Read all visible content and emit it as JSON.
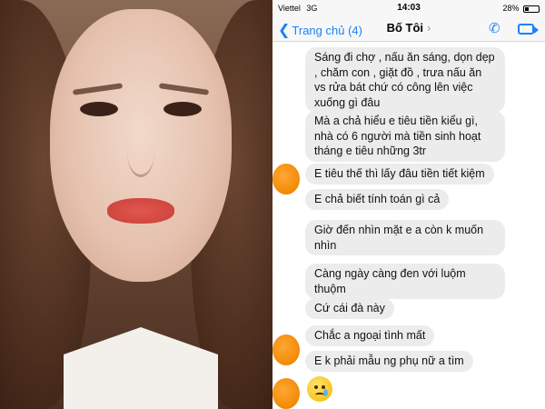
{
  "status_bar": {
    "carrier": "Viettel",
    "network": "3G",
    "time": "14:03",
    "battery": "28%"
  },
  "nav": {
    "back_label": "Trang chủ (4)",
    "contact_name": "Bố Tôi"
  },
  "messages": [
    "Sáng đi chợ , nấu ăn sáng, dọn dẹp , chăm con , giặt đồ , trưa nấu ăn vs rửa bát chứ có công lên việc xuống gì đâu",
    "Mà a chả hiểu e tiêu tiền kiểu gì, nhà có 6 người mà tiền sinh hoạt tháng e tiêu những 3tr",
    "E tiêu thế thì lấy đâu tiền tiết kiệm",
    "E chả biết tính toán gì cả",
    "Giờ đến nhìn mặt e a còn k muốn nhìn",
    "Càng ngày càng đen với luộm thuộm",
    "Cứ cái đà này",
    "Chắc a ngoại tình mất",
    "E k phải mẫu ng phụ nữ a tìm"
  ],
  "colors": {
    "ios_blue": "#1a82f7",
    "bubble_gray": "#ececec",
    "avatar_orange": "#f28a05"
  }
}
